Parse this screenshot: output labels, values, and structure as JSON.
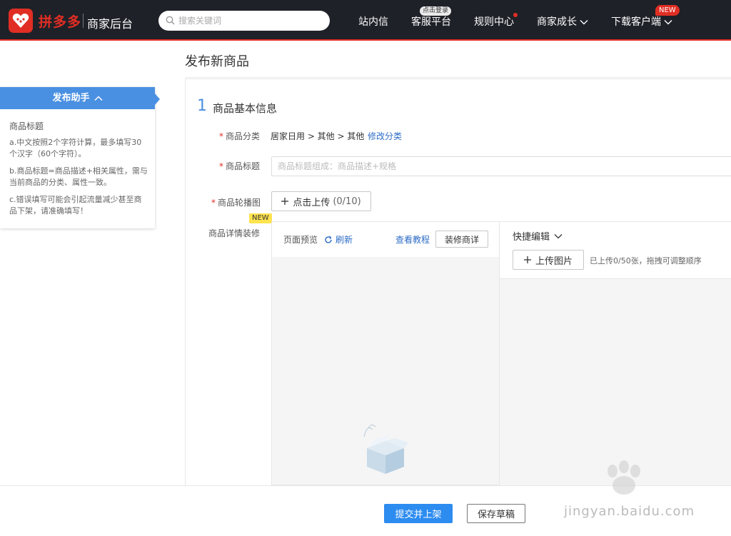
{
  "topbar": {
    "brand": "拼多多",
    "subtitle": "商家后台",
    "search_placeholder": "搜索关键词",
    "nav": [
      {
        "label": "站内信"
      },
      {
        "label": "客服平台",
        "badge": "点击登录"
      },
      {
        "label": "规则中心",
        "dot": true
      },
      {
        "label": "商家成长"
      },
      {
        "label": "下载客户端",
        "badge": "NEW"
      }
    ]
  },
  "page": {
    "title": "发布新商品"
  },
  "helper": {
    "title": "发布助手",
    "heading": "商品标题",
    "tips": [
      "a.中文按照2个字符计算，最多填写30个汉字（60个字符）。",
      "b.商品标题=商品描述+相关属性，需与当前商品的分类、属性一致。",
      "c.错误填写可能会引起流量减少甚至商品下架，请准确填写！"
    ]
  },
  "section": {
    "number": "1",
    "title": "商品基本信息"
  },
  "form": {
    "category_label": "商品分类",
    "category_path": "居家日用 > 其他 > 其他",
    "category_edit": "修改分类",
    "title_label": "商品标题",
    "title_placeholder": "商品标题组成：商品描述+规格",
    "carousel_label": "商品轮播图",
    "carousel_button": "点击上传",
    "carousel_count": "(0/10)",
    "detail_label": "商品详情装修",
    "detail_badge": "NEW"
  },
  "editor": {
    "preview_label": "页面预览",
    "refresh": "刷新",
    "tutorial": "查看教程",
    "decorate": "装修商详",
    "quick_edit": "快捷编辑",
    "upload_image": "上传图片",
    "upload_hint": "已上传0/50张，拖拽可调整顺序"
  },
  "footer": {
    "submit": "提交并上架",
    "draft": "保存草稿"
  },
  "watermark": {
    "text": "jingyan.baidu.com"
  },
  "colors": {
    "brand": "#e02e24",
    "primary": "#2d8cf0",
    "link": "#2d6cc6",
    "helper": "#4a90e2"
  }
}
